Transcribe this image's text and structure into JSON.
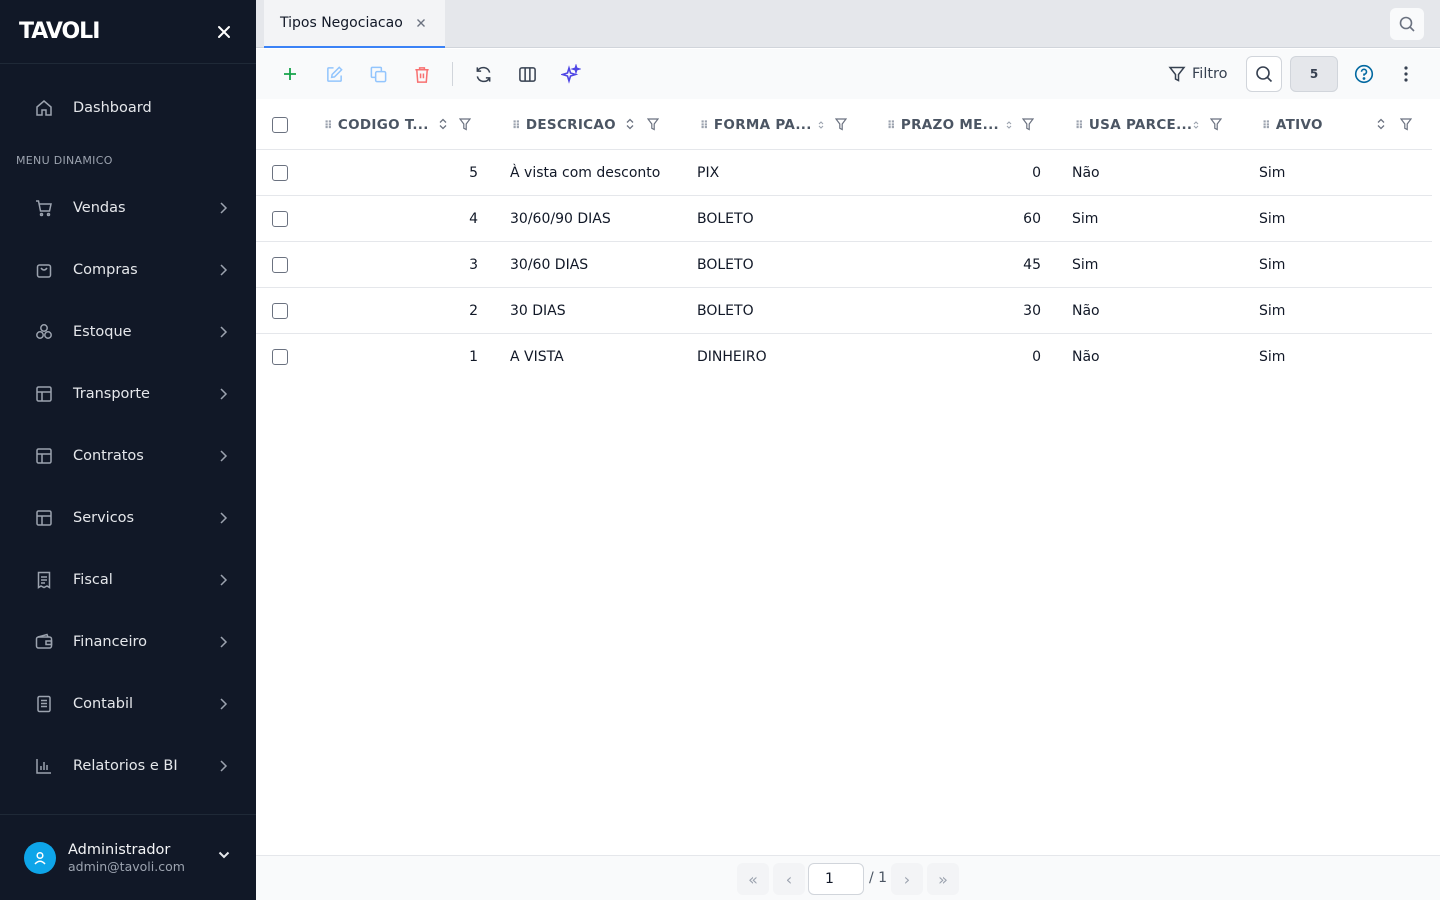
{
  "app": {
    "logo": "TAVOLI"
  },
  "sidebar": {
    "dashboard_label": "Dashboard",
    "section_title": "MENU DINAMICO",
    "items": [
      {
        "label": "Vendas",
        "icon": "cart-icon"
      },
      {
        "label": "Compras",
        "icon": "bag-icon"
      },
      {
        "label": "Estoque",
        "icon": "boxes-icon"
      },
      {
        "label": "Transporte",
        "icon": "table-icon"
      },
      {
        "label": "Contratos",
        "icon": "table-icon"
      },
      {
        "label": "Servicos",
        "icon": "table-icon"
      },
      {
        "label": "Fiscal",
        "icon": "receipt-icon"
      },
      {
        "label": "Financeiro",
        "icon": "wallet-icon"
      },
      {
        "label": "Contabil",
        "icon": "book-icon"
      },
      {
        "label": "Relatorios e BI",
        "icon": "bar-chart-icon"
      }
    ],
    "user": {
      "name": "Administrador",
      "email": "admin@tavoli.com"
    }
  },
  "tabs": [
    {
      "label": "Tipos Negociacao"
    }
  ],
  "toolbar": {
    "filter_label": "Filtro",
    "record_count": "5"
  },
  "table": {
    "columns": [
      {
        "label": "CODIGO T..."
      },
      {
        "label": "DESCRICAO"
      },
      {
        "label": "FORMA PA..."
      },
      {
        "label": "PRAZO ME..."
      },
      {
        "label": "USA PARCE..."
      },
      {
        "label": "ATIVO"
      }
    ],
    "rows": [
      {
        "codigo": "5",
        "descricao": "À vista com desconto",
        "forma": "PIX",
        "prazo": "0",
        "usa_parcela": "Não",
        "ativo": "Sim"
      },
      {
        "codigo": "4",
        "descricao": "30/60/90 DIAS",
        "forma": "BOLETO",
        "prazo": "60",
        "usa_parcela": "Sim",
        "ativo": "Sim"
      },
      {
        "codigo": "3",
        "descricao": "30/60 DIAS",
        "forma": "BOLETO",
        "prazo": "45",
        "usa_parcela": "Sim",
        "ativo": "Sim"
      },
      {
        "codigo": "2",
        "descricao": "30 DIAS",
        "forma": "BOLETO",
        "prazo": "30",
        "usa_parcela": "Não",
        "ativo": "Sim"
      },
      {
        "codigo": "1",
        "descricao": "A VISTA",
        "forma": "DINHEIRO",
        "prazo": "0",
        "usa_parcela": "Não",
        "ativo": "Sim"
      }
    ]
  },
  "pager": {
    "first": "«",
    "prev": "‹",
    "next": "›",
    "last": "»",
    "current_page": "1",
    "total_label": "/ 1"
  },
  "colors": {
    "sidebar_bg": "#111827",
    "accent_blue": "#3b82f6",
    "add_green": "#16a34a",
    "delete_red": "#ef4444",
    "ai_purple": "#4f46e5",
    "help_blue": "#0369a1"
  }
}
